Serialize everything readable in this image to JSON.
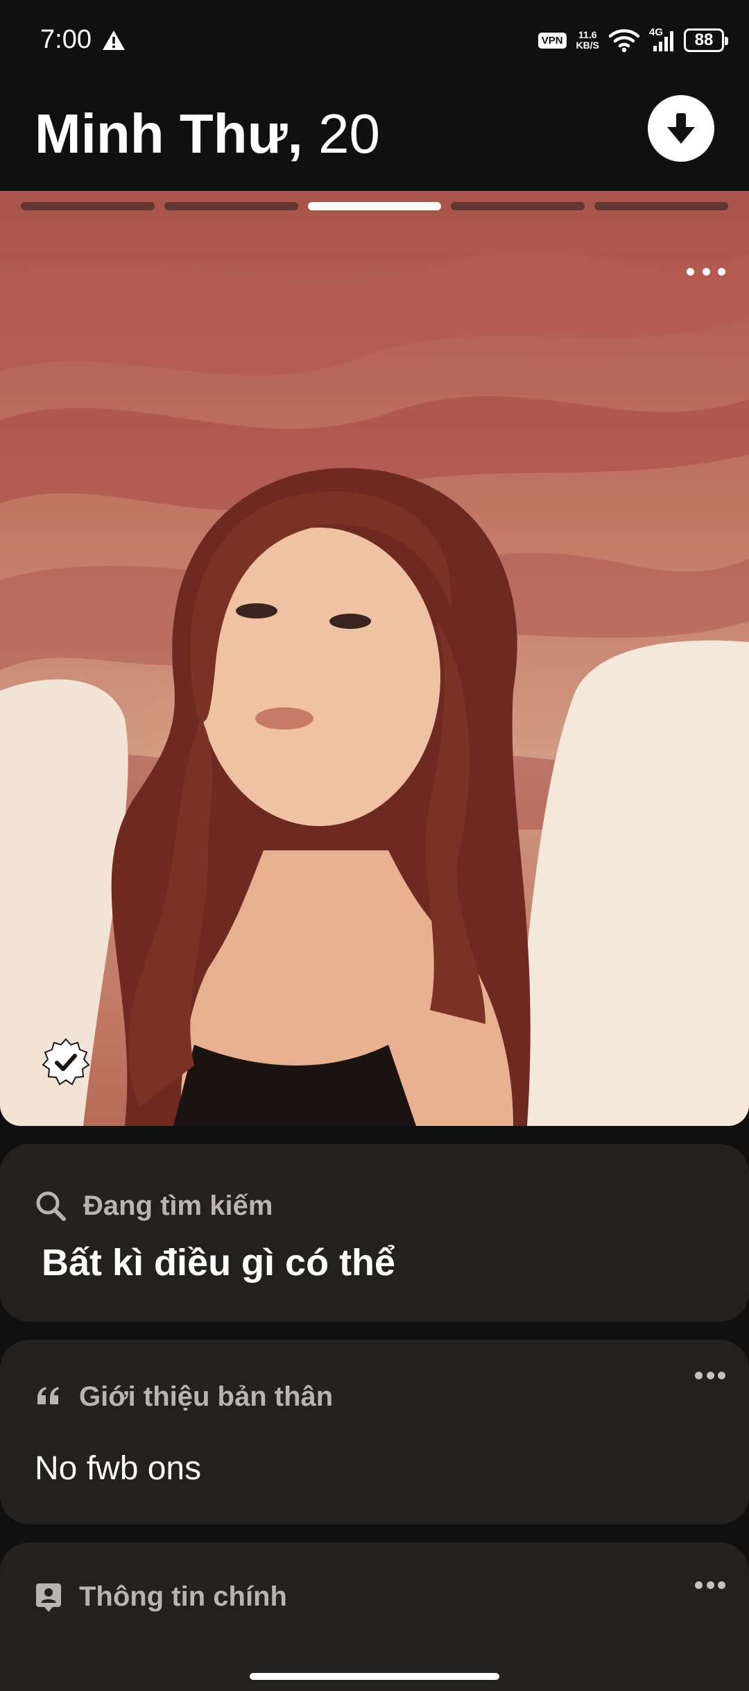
{
  "status_bar": {
    "time": "7:00",
    "vpn": "VPN",
    "net_speed_value": "11.6",
    "net_speed_unit": "KB/S",
    "network_type": "4G",
    "battery": "88"
  },
  "header": {
    "name": "Minh Thư,",
    "age": "20"
  },
  "photo": {
    "segments_total": 5,
    "active_segment": 3
  },
  "cards": {
    "looking_for": {
      "label": "Đang tìm kiếm",
      "value": "Bất kì điều gì có thể"
    },
    "about": {
      "label": "Giới thiệu bản thân",
      "value": "No fwb ons"
    },
    "basics": {
      "label": "Thông tin chính"
    }
  }
}
